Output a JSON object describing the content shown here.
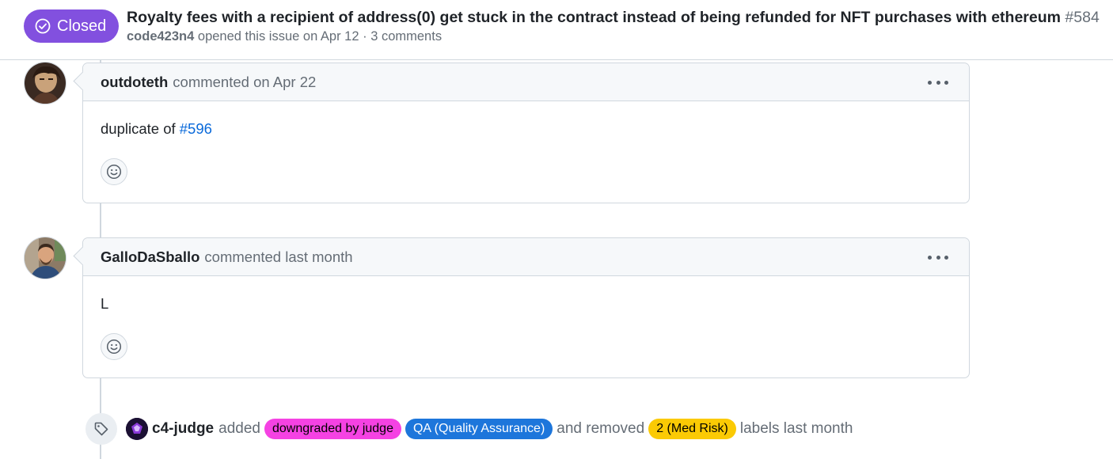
{
  "header": {
    "state": "Closed",
    "title": "Royalty fees with a recipient of address(0) get stuck in the contract instead of being refunded for NFT purchases with ethereum",
    "number": "#584",
    "author": "code423n4",
    "meta_text": "opened this issue on Apr 12 · 3 comments"
  },
  "comments": [
    {
      "author": "outdoteth",
      "action": "commented on Apr 22",
      "body_prefix": "duplicate of",
      "body_link": "#596"
    },
    {
      "author": "GalloDaSballo",
      "action": "commented last month",
      "body": "L"
    }
  ],
  "event": {
    "actor": "c4-judge",
    "added_text": "added",
    "labels_added": [
      {
        "name": "downgraded by judge",
        "color": "#f542e3"
      },
      {
        "name": "QA (Quality Assurance)",
        "color": "#1d76db"
      }
    ],
    "removed_text": "and removed",
    "labels_removed": [
      {
        "name": "2 (Med Risk)",
        "color": "#fbca04"
      }
    ],
    "suffix": "labels last month"
  },
  "colors": {
    "closed_badge": "#8250df",
    "link": "#0969da"
  }
}
